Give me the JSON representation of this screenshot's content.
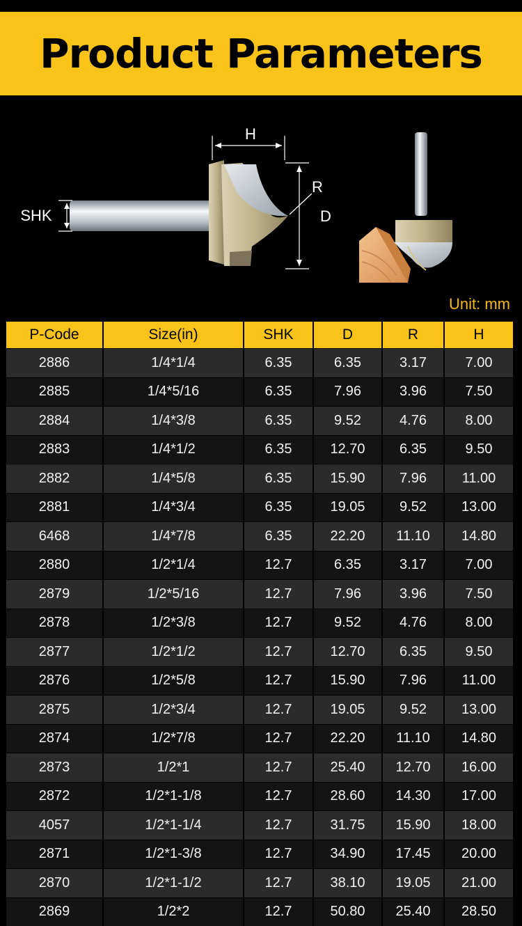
{
  "title": "Product Parameters",
  "diagram_labels": {
    "h": "H",
    "r": "R",
    "d": "D",
    "shk": "SHK"
  },
  "unit_text": "Unit: mm",
  "table": {
    "headers": [
      "P-Code",
      "Size(in)",
      "SHK",
      "D",
      "R",
      "H"
    ],
    "rows": [
      [
        "2886",
        "1/4*1/4",
        "6.35",
        "6.35",
        "3.17",
        "7.00"
      ],
      [
        "2885",
        "1/4*5/16",
        "6.35",
        "7.96",
        "3.96",
        "7.50"
      ],
      [
        "2884",
        "1/4*3/8",
        "6.35",
        "9.52",
        "4.76",
        "8.00"
      ],
      [
        "2883",
        "1/4*1/2",
        "6.35",
        "12.70",
        "6.35",
        "9.50"
      ],
      [
        "2882",
        "1/4*5/8",
        "6.35",
        "15.90",
        "7.96",
        "11.00"
      ],
      [
        "2881",
        "1/4*3/4",
        "6.35",
        "19.05",
        "9.52",
        "13.00"
      ],
      [
        "6468",
        "1/4*7/8",
        "6.35",
        "22.20",
        "11.10",
        "14.80"
      ],
      [
        "2880",
        "1/2*1/4",
        "12.7",
        "6.35",
        "3.17",
        "7.00"
      ],
      [
        "2879",
        "1/2*5/16",
        "12.7",
        "7.96",
        "3.96",
        "7.50"
      ],
      [
        "2878",
        "1/2*3/8",
        "12.7",
        "9.52",
        "4.76",
        "8.00"
      ],
      [
        "2877",
        "1/2*1/2",
        "12.7",
        "12.70",
        "6.35",
        "9.50"
      ],
      [
        "2876",
        "1/2*5/8",
        "12.7",
        "15.90",
        "7.96",
        "11.00"
      ],
      [
        "2875",
        "1/2*3/4",
        "12.7",
        "19.05",
        "9.52",
        "13.00"
      ],
      [
        "2874",
        "1/2*7/8",
        "12.7",
        "22.20",
        "11.10",
        "14.80"
      ],
      [
        "2873",
        "1/2*1",
        "12.7",
        "25.40",
        "12.70",
        "16.00"
      ],
      [
        "2872",
        "1/2*1-1/8",
        "12.7",
        "28.60",
        "14.30",
        "17.00"
      ],
      [
        "4057",
        "1/2*1-1/4",
        "12.7",
        "31.75",
        "15.90",
        "18.00"
      ],
      [
        "2871",
        "1/2*1-3/8",
        "12.7",
        "34.90",
        "17.45",
        "20.00"
      ],
      [
        "2870",
        "1/2*1-1/2",
        "12.7",
        "38.10",
        "19.05",
        "21.00"
      ],
      [
        "2869",
        "1/2*2",
        "12.7",
        "50.80",
        "25.40",
        "28.50"
      ]
    ]
  }
}
